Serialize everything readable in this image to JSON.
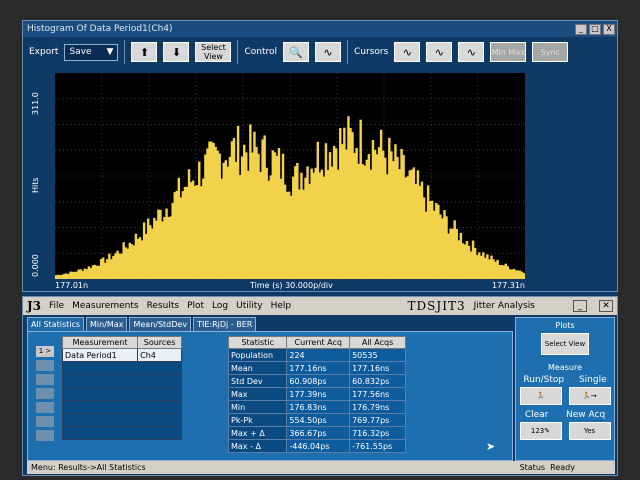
{
  "histogram_window": {
    "title": "Histogram Of Data Period1(Ch4)",
    "window_buttons": [
      "_",
      "□",
      "X"
    ],
    "toolbar": {
      "export_label": "Export",
      "save_value": "Save",
      "select_view_label": "Select View",
      "control_label": "Control",
      "cursors_label": "Cursors",
      "minmax_label": "Min Max",
      "sync_label": "Sync"
    }
  },
  "chart_data": {
    "type": "bar",
    "ylabel": "Hits",
    "ylim": [
      0,
      311
    ],
    "ytick_labels": [
      "311.0",
      "0.000"
    ],
    "xlabel": "Time (s)  30.000p/div",
    "x_start_label": "177.01n",
    "x_end_label": "177.31n",
    "xlim_ns": [
      177.01,
      177.31
    ],
    "background": "#000000",
    "bar_color": "#f2d24a",
    "peaks": [
      {
        "x_ns": 177.13,
        "hits": 224
      },
      {
        "x_ns": 177.2,
        "hits": 240
      }
    ]
  },
  "jitter_window": {
    "logo": "J3",
    "menu": [
      "File",
      "Measurements",
      "Results",
      "Plot",
      "Log",
      "Utility",
      "Help"
    ],
    "brand": "TDSJIT3",
    "subtitle": "Jitter Analysis",
    "tabs": [
      "All Statistics",
      "Min/Max",
      "Mean/StdDev",
      "TIE:RjDj - BER"
    ],
    "row_buttons": [
      "1 >",
      "",
      "",
      "",
      "",
      "",
      ""
    ],
    "measurement_headers": [
      "Measurement",
      "Sources"
    ],
    "measurements": [
      [
        "Data Period1",
        "Ch4"
      ]
    ],
    "stats_headers": [
      "Statistic",
      "Current Acq",
      "All Acqs"
    ],
    "stats": [
      [
        "Population",
        "224",
        "50535"
      ],
      [
        "Mean",
        "177.16ns",
        "177.16ns"
      ],
      [
        "Std Dev",
        "60.908ps",
        "60.832ps"
      ],
      [
        "Max",
        "177.39ns",
        "177.56ns"
      ],
      [
        "Min",
        "176.83ns",
        "176.79ns"
      ],
      [
        "Pk-Pk",
        "554.50ps",
        "769.77ps"
      ],
      [
        "Max + Δ",
        "366.67ps",
        "716.32ps"
      ],
      [
        "Max - Δ",
        "-446.04ps",
        "-761.55ps"
      ]
    ],
    "side": {
      "plots_label": "Plots",
      "select_view": "Select View",
      "measure_label": "Measure",
      "run_stop": "Run/Stop",
      "single": "Single",
      "clear": "Clear",
      "new_acq": "New Acq",
      "yes": "Yes"
    },
    "status_menu": "Menu: Results->All Statistics",
    "status_label": "Status",
    "status_value": "Ready"
  }
}
